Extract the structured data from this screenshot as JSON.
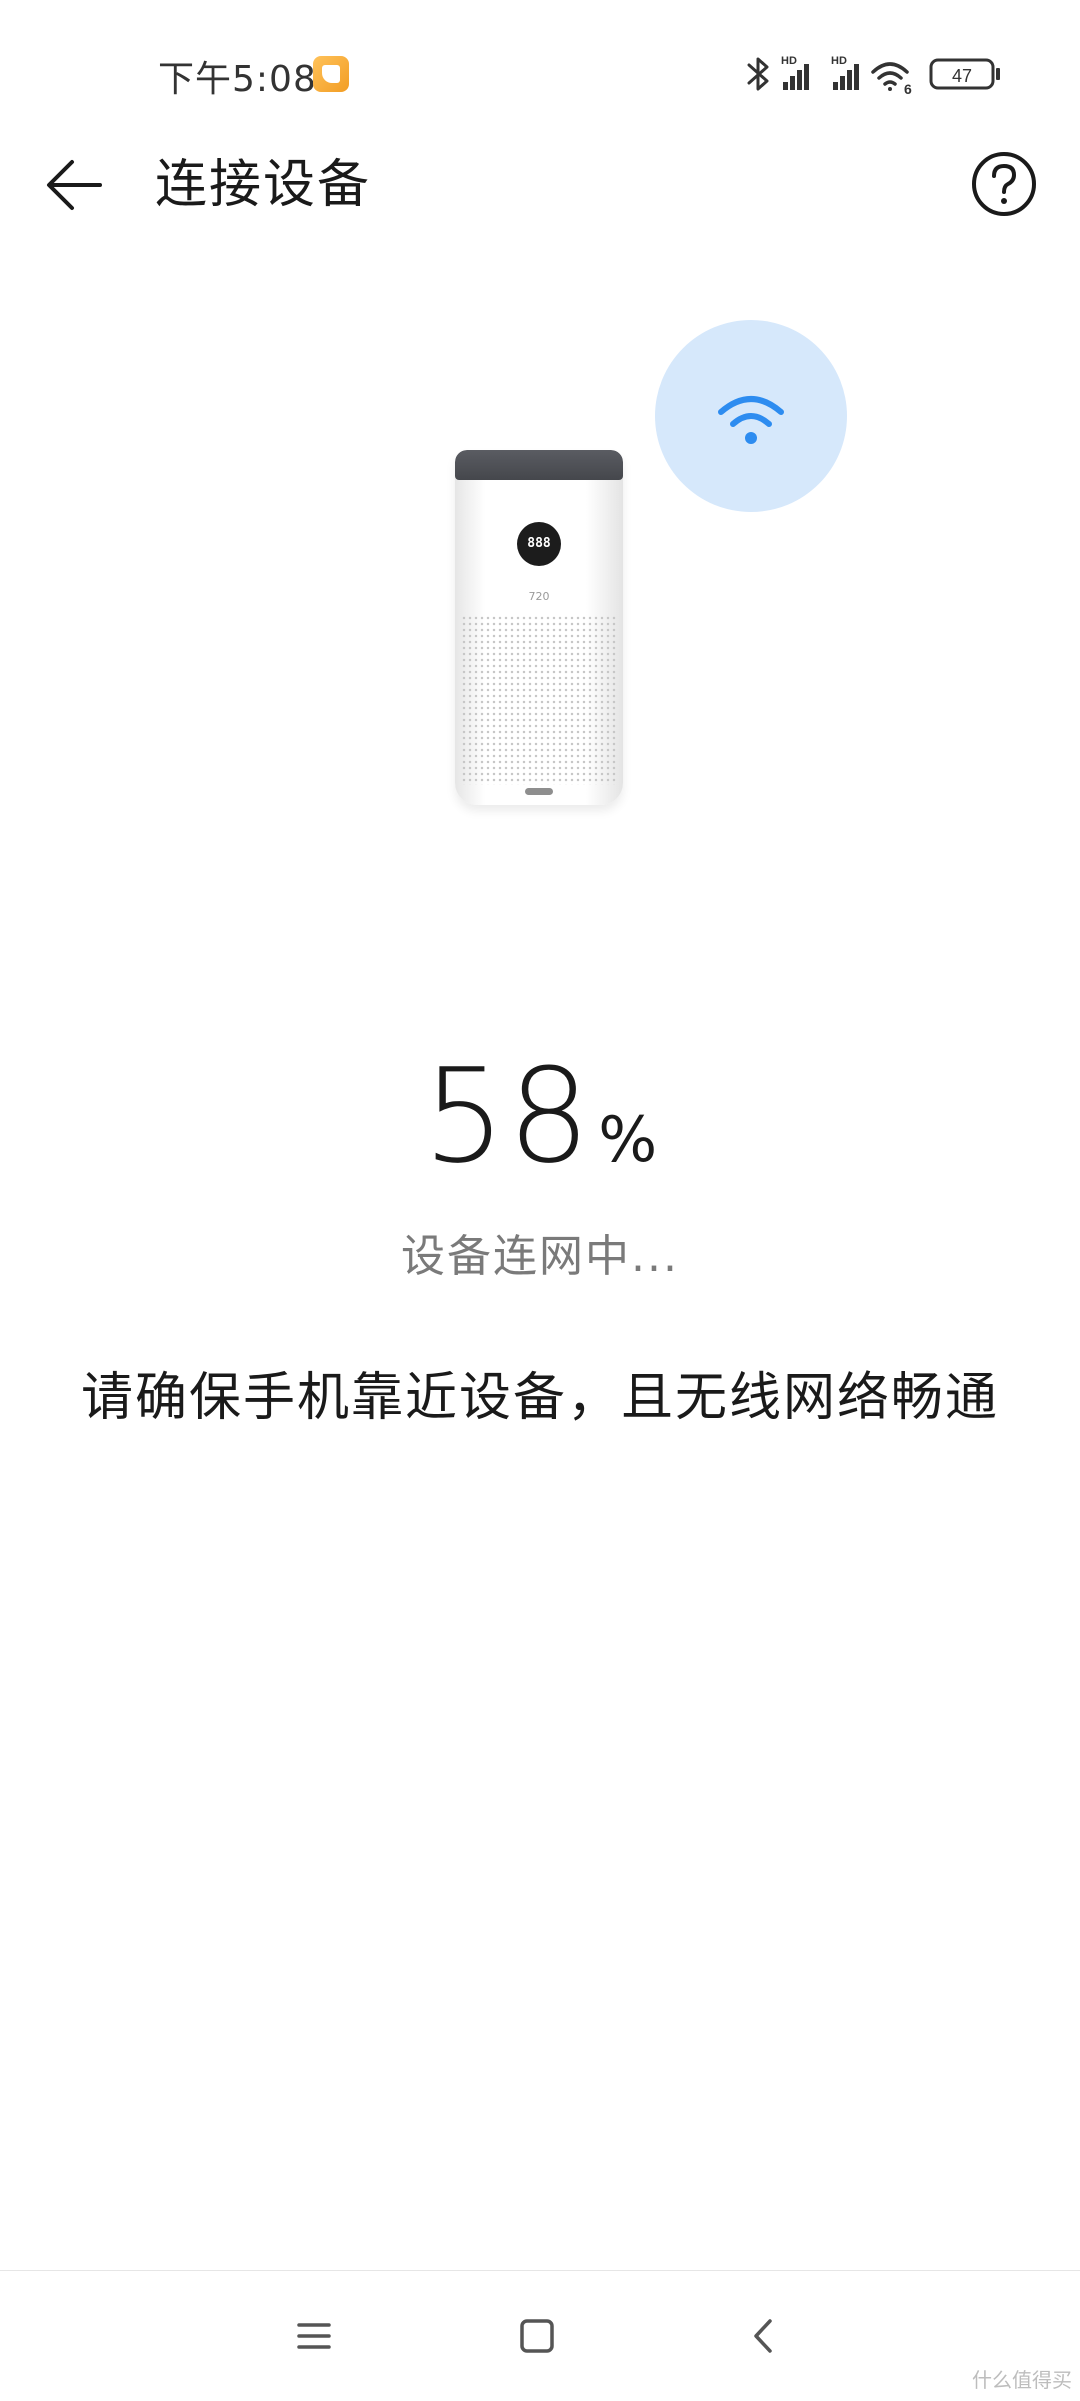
{
  "status_bar": {
    "time": "下午5:08",
    "battery": "47",
    "signal_label": "HD",
    "wifi_badge": "6"
  },
  "header": {
    "title": "连接设备"
  },
  "device": {
    "display_digits": "888",
    "model_label": "720"
  },
  "progress": {
    "value": "58",
    "unit": "%",
    "status": "设备连网中..."
  },
  "hint": "请确保手机靠近设备，且无线网络畅通",
  "watermark": "什么值得买",
  "colors": {
    "accent_blue": "#2d8cf0",
    "bubble_bg": "#d6e8fb"
  }
}
